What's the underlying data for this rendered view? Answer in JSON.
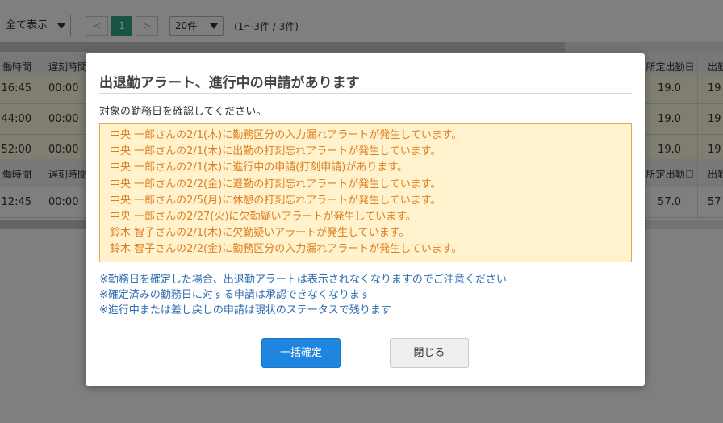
{
  "toolbar": {
    "view_select": "全て表示",
    "pagination": {
      "prev": "<",
      "current": "1",
      "next": ">"
    },
    "page_size": "20件",
    "range_info": "(1〜3件 / 3件)"
  },
  "grid": {
    "header": [
      "働時間",
      "遅刻時間",
      "所定出勤日",
      "出勤"
    ],
    "rows": [
      [
        "16:45",
        "00:00",
        "19.0",
        "19"
      ],
      [
        "44:00",
        "00:00",
        "19.0",
        "19"
      ],
      [
        "52:00",
        "00:00",
        "19.0",
        "19"
      ]
    ],
    "summary_header": [
      "働時間",
      "遅刻時間",
      "所定出勤日",
      "出勤"
    ],
    "summary_row": [
      "12:45",
      "00:00",
      "57.0",
      "57"
    ]
  },
  "modal": {
    "title": "出退勤アラート、進行中の申請があります",
    "subtitle": "対象の勤務日を確認してください。",
    "alerts": [
      "中央 一郎さんの2/1(木)に勤務区分の入力漏れアラートが発生しています。",
      "中央 一郎さんの2/1(木)に出勤の打刻忘れアラートが発生しています。",
      "中央 一郎さんの2/1(木)に進行中の申請(打刻申請)があります。",
      "中央 一郎さんの2/2(金)に退勤の打刻忘れアラートが発生しています。",
      "中央 一郎さんの2/5(月)に休憩の打刻忘れアラートが発生しています。",
      "中央 一郎さんの2/27(火)に欠勤疑いアラートが発生しています。",
      "鈴木 智子さんの2/1(木)に欠勤疑いアラートが発生しています。",
      "鈴木 智子さんの2/2(金)に勤務区分の入力漏れアラートが発生しています。"
    ],
    "notes": [
      "※勤務日を確定した場合、出退勤アラートは表示されなくなりますのでご注意ください",
      "※確定済みの勤務日に対する申請は承認できなくなります",
      "※進行中または差し戻しの申請は現状のステータスで残ります"
    ],
    "confirm_button": "一括確定",
    "close_button": "閉じる"
  },
  "colors": {
    "primary": "#1f86e0",
    "alert_bg": "#fff2cc",
    "alert_border": "#e3a94f",
    "alert_text": "#e07d1e",
    "note_text": "#2d6db3",
    "pagination_active": "#2fa888"
  }
}
